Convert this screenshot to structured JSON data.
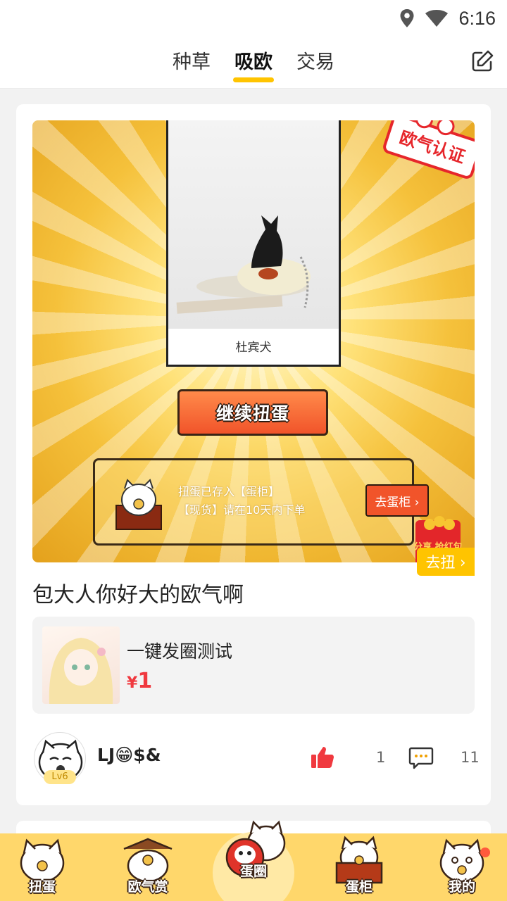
{
  "status_bar": {
    "time": "6:16",
    "icons": [
      "location-icon",
      "wifi-icon"
    ]
  },
  "top_nav": {
    "tabs": [
      {
        "label": "种草",
        "active": false
      },
      {
        "label": "吸欧",
        "active": true
      },
      {
        "label": "交易",
        "active": false
      }
    ],
    "edit_icon": "edit-icon"
  },
  "post": {
    "image": {
      "caption": "杜宾犬",
      "continue_button": "继续扭蛋",
      "notice_line1": "扭蛋已存入【蛋柜】",
      "notice_line2": "【现货】请在10天内下单",
      "go_cabinet_button": "去蛋柜 ›",
      "stamp_text": "欧气认证",
      "red_packet_text": "分享 抢红包"
    },
    "title": "包大人你好大的欧气啊",
    "product": {
      "name": "一键发圈测试",
      "currency": "¥",
      "price": "1",
      "go_button": "去扭 ›"
    },
    "author": {
      "name": "LJ😁$&",
      "level": "Lv6"
    },
    "likes": "1",
    "comments": "11"
  },
  "bottom_nav": {
    "items": [
      {
        "label": "扭蛋",
        "icon": "lucky-cat-icon"
      },
      {
        "label": "欧气赏",
        "icon": "lucky-cat-box-icon"
      },
      {
        "label": "蛋圈",
        "icon": "daruma-cat-icon"
      },
      {
        "label": "蛋柜",
        "icon": "cabinet-cat-icon"
      },
      {
        "label": "我的",
        "icon": "profile-cat-icon"
      }
    ]
  },
  "colors": {
    "accent": "#ffc400",
    "price": "#f0393f",
    "button_orange": "#f1542a",
    "nav_bg": "#ffd76b"
  }
}
